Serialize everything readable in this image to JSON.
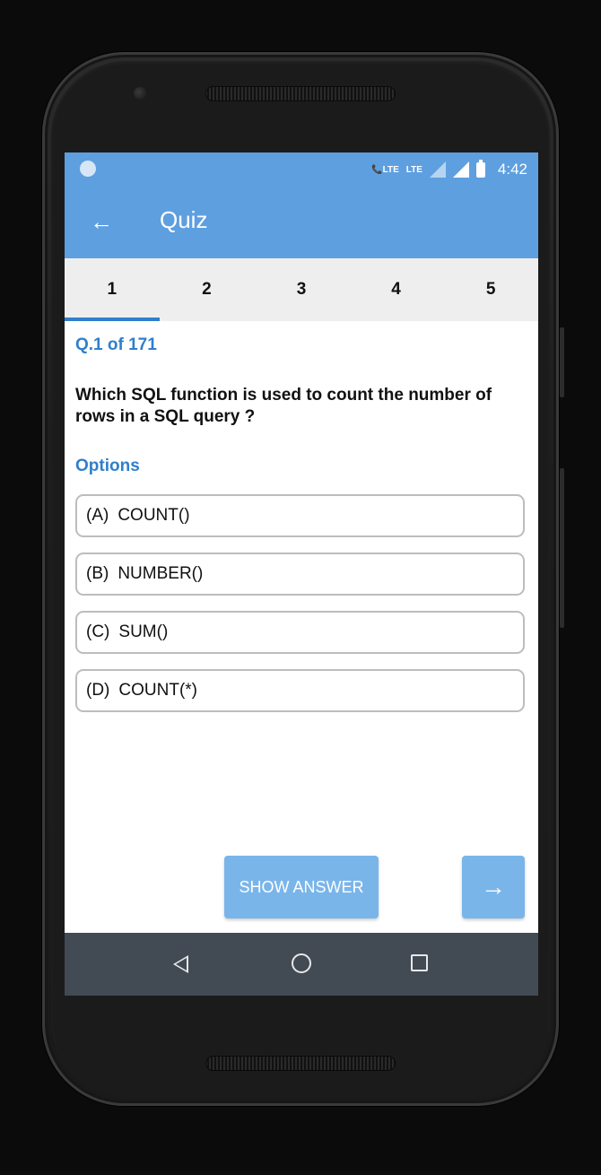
{
  "status_bar": {
    "signal_label_1": "LTE",
    "signal_label_2": "LTE",
    "time": "4:42"
  },
  "appbar": {
    "title": "Quiz",
    "back_icon": "arrow-left-icon"
  },
  "tabs": [
    {
      "label": "1",
      "active": true
    },
    {
      "label": "2",
      "active": false
    },
    {
      "label": "3",
      "active": false
    },
    {
      "label": "4",
      "active": false
    },
    {
      "label": "5",
      "active": false
    }
  ],
  "question": {
    "counter": "Q.1 of 171",
    "text": "Which SQL function is used to count the number of rows in a SQL query ?"
  },
  "options": {
    "label": "Options",
    "items": [
      {
        "letter": "(A)",
        "text": "COUNT()"
      },
      {
        "letter": "(B)",
        "text": "NUMBER()"
      },
      {
        "letter": "(C)",
        "text": "SUM()"
      },
      {
        "letter": "(D)",
        "text": "COUNT(*)"
      }
    ]
  },
  "actions": {
    "show_answer": "SHOW ANSWER",
    "next_icon": "arrow-right-icon"
  },
  "colors": {
    "primary": "#5e9fe0",
    "accent": "#2f7fcc",
    "button": "#7ab5ea",
    "navbar": "#424b54"
  }
}
